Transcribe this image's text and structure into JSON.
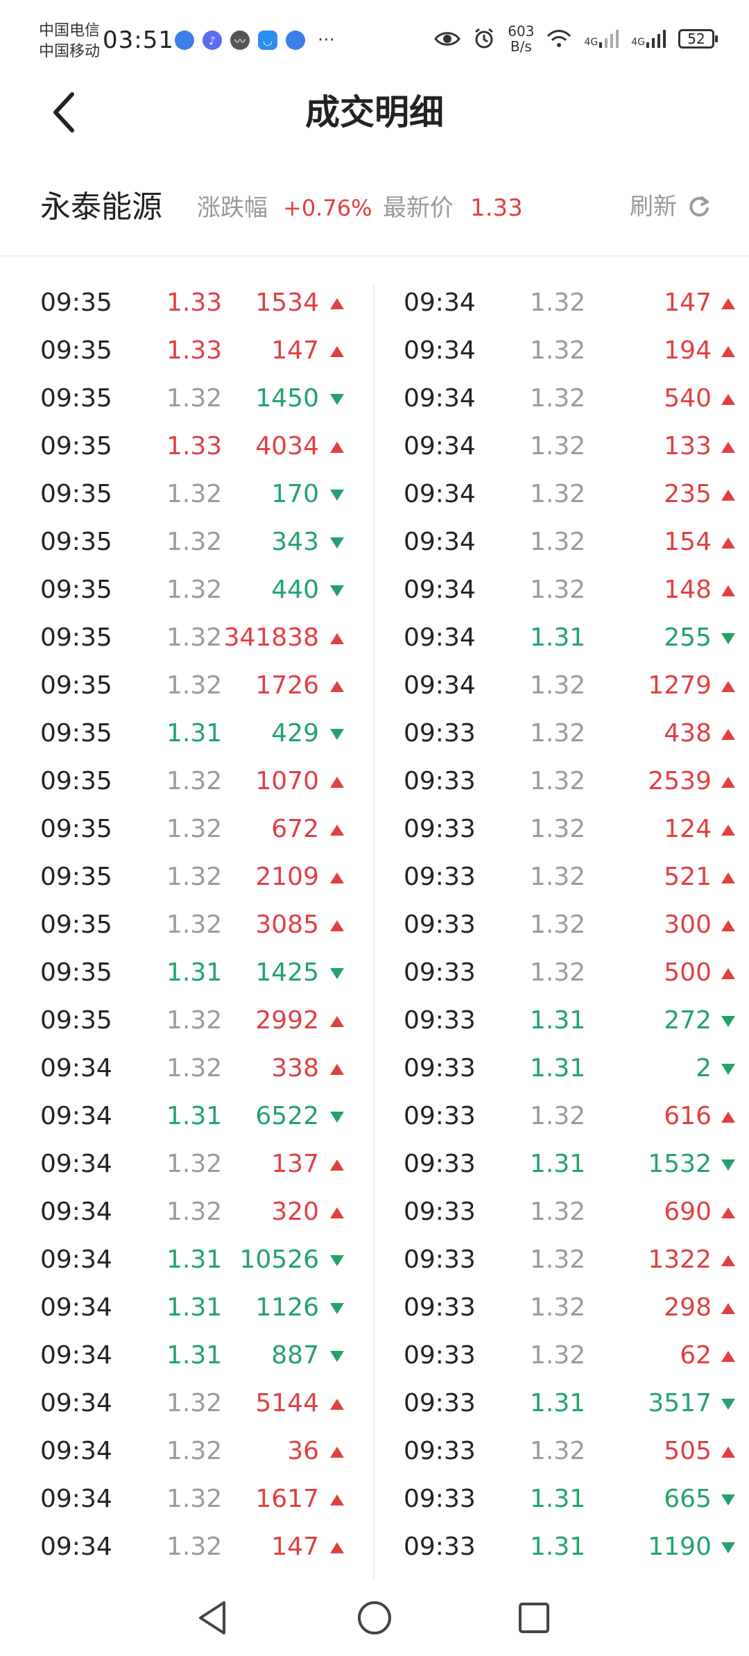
{
  "status_bar": {
    "carrier1": "中国电信",
    "carrier2": "中国移动",
    "time": "03:51",
    "net_speed_value": "603",
    "net_speed_unit": "B/s",
    "signal1": "4G",
    "signal2": "4G",
    "battery": "52"
  },
  "header": {
    "title": "成交明细"
  },
  "stock": {
    "name": "永泰能源",
    "change_label": "涨跌幅",
    "change_value": "+0.76%",
    "price_label": "最新价",
    "price_value": "1.33",
    "refresh_label": "刷新"
  },
  "colors": {
    "up": "#e04040",
    "down": "#22a36a",
    "flat": "#9a9a9a"
  },
  "trades_left": [
    {
      "time": "09:35",
      "price": "1.33",
      "volume": "1534",
      "dir": "up",
      "price_dir": "up"
    },
    {
      "time": "09:35",
      "price": "1.33",
      "volume": "147",
      "dir": "up",
      "price_dir": "up"
    },
    {
      "time": "09:35",
      "price": "1.32",
      "volume": "1450",
      "dir": "down",
      "price_dir": "flat"
    },
    {
      "time": "09:35",
      "price": "1.33",
      "volume": "4034",
      "dir": "up",
      "price_dir": "up"
    },
    {
      "time": "09:35",
      "price": "1.32",
      "volume": "170",
      "dir": "down",
      "price_dir": "flat"
    },
    {
      "time": "09:35",
      "price": "1.32",
      "volume": "343",
      "dir": "down",
      "price_dir": "flat"
    },
    {
      "time": "09:35",
      "price": "1.32",
      "volume": "440",
      "dir": "down",
      "price_dir": "flat"
    },
    {
      "time": "09:35",
      "price": "1.32",
      "volume": "341838",
      "dir": "up",
      "price_dir": "flat"
    },
    {
      "time": "09:35",
      "price": "1.32",
      "volume": "1726",
      "dir": "up",
      "price_dir": "flat"
    },
    {
      "time": "09:35",
      "price": "1.31",
      "volume": "429",
      "dir": "down",
      "price_dir": "down"
    },
    {
      "time": "09:35",
      "price": "1.32",
      "volume": "1070",
      "dir": "up",
      "price_dir": "flat"
    },
    {
      "time": "09:35",
      "price": "1.32",
      "volume": "672",
      "dir": "up",
      "price_dir": "flat"
    },
    {
      "time": "09:35",
      "price": "1.32",
      "volume": "2109",
      "dir": "up",
      "price_dir": "flat"
    },
    {
      "time": "09:35",
      "price": "1.32",
      "volume": "3085",
      "dir": "up",
      "price_dir": "flat"
    },
    {
      "time": "09:35",
      "price": "1.31",
      "volume": "1425",
      "dir": "down",
      "price_dir": "down"
    },
    {
      "time": "09:35",
      "price": "1.32",
      "volume": "2992",
      "dir": "up",
      "price_dir": "flat"
    },
    {
      "time": "09:34",
      "price": "1.32",
      "volume": "338",
      "dir": "up",
      "price_dir": "flat"
    },
    {
      "time": "09:34",
      "price": "1.31",
      "volume": "6522",
      "dir": "down",
      "price_dir": "down"
    },
    {
      "time": "09:34",
      "price": "1.32",
      "volume": "137",
      "dir": "up",
      "price_dir": "flat"
    },
    {
      "time": "09:34",
      "price": "1.32",
      "volume": "320",
      "dir": "up",
      "price_dir": "flat"
    },
    {
      "time": "09:34",
      "price": "1.31",
      "volume": "10526",
      "dir": "down",
      "price_dir": "down"
    },
    {
      "time": "09:34",
      "price": "1.31",
      "volume": "1126",
      "dir": "down",
      "price_dir": "down"
    },
    {
      "time": "09:34",
      "price": "1.31",
      "volume": "887",
      "dir": "down",
      "price_dir": "down"
    },
    {
      "time": "09:34",
      "price": "1.32",
      "volume": "5144",
      "dir": "up",
      "price_dir": "flat"
    },
    {
      "time": "09:34",
      "price": "1.32",
      "volume": "36",
      "dir": "up",
      "price_dir": "flat"
    },
    {
      "time": "09:34",
      "price": "1.32",
      "volume": "1617",
      "dir": "up",
      "price_dir": "flat"
    },
    {
      "time": "09:34",
      "price": "1.32",
      "volume": "147",
      "dir": "up",
      "price_dir": "flat"
    }
  ],
  "trades_right": [
    {
      "time": "09:34",
      "price": "1.32",
      "volume": "147",
      "dir": "up",
      "price_dir": "flat"
    },
    {
      "time": "09:34",
      "price": "1.32",
      "volume": "194",
      "dir": "up",
      "price_dir": "flat"
    },
    {
      "time": "09:34",
      "price": "1.32",
      "volume": "540",
      "dir": "up",
      "price_dir": "flat"
    },
    {
      "time": "09:34",
      "price": "1.32",
      "volume": "133",
      "dir": "up",
      "price_dir": "flat"
    },
    {
      "time": "09:34",
      "price": "1.32",
      "volume": "235",
      "dir": "up",
      "price_dir": "flat"
    },
    {
      "time": "09:34",
      "price": "1.32",
      "volume": "154",
      "dir": "up",
      "price_dir": "flat"
    },
    {
      "time": "09:34",
      "price": "1.32",
      "volume": "148",
      "dir": "up",
      "price_dir": "flat"
    },
    {
      "time": "09:34",
      "price": "1.31",
      "volume": "255",
      "dir": "down",
      "price_dir": "down"
    },
    {
      "time": "09:34",
      "price": "1.32",
      "volume": "1279",
      "dir": "up",
      "price_dir": "flat"
    },
    {
      "time": "09:33",
      "price": "1.32",
      "volume": "438",
      "dir": "up",
      "price_dir": "flat"
    },
    {
      "time": "09:33",
      "price": "1.32",
      "volume": "2539",
      "dir": "up",
      "price_dir": "flat"
    },
    {
      "time": "09:33",
      "price": "1.32",
      "volume": "124",
      "dir": "up",
      "price_dir": "flat"
    },
    {
      "time": "09:33",
      "price": "1.32",
      "volume": "521",
      "dir": "up",
      "price_dir": "flat"
    },
    {
      "time": "09:33",
      "price": "1.32",
      "volume": "300",
      "dir": "up",
      "price_dir": "flat"
    },
    {
      "time": "09:33",
      "price": "1.32",
      "volume": "500",
      "dir": "up",
      "price_dir": "flat"
    },
    {
      "time": "09:33",
      "price": "1.31",
      "volume": "272",
      "dir": "down",
      "price_dir": "down"
    },
    {
      "time": "09:33",
      "price": "1.31",
      "volume": "2",
      "dir": "down",
      "price_dir": "down"
    },
    {
      "time": "09:33",
      "price": "1.32",
      "volume": "616",
      "dir": "up",
      "price_dir": "flat"
    },
    {
      "time": "09:33",
      "price": "1.31",
      "volume": "1532",
      "dir": "down",
      "price_dir": "down"
    },
    {
      "time": "09:33",
      "price": "1.32",
      "volume": "690",
      "dir": "up",
      "price_dir": "flat"
    },
    {
      "time": "09:33",
      "price": "1.32",
      "volume": "1322",
      "dir": "up",
      "price_dir": "flat"
    },
    {
      "time": "09:33",
      "price": "1.32",
      "volume": "298",
      "dir": "up",
      "price_dir": "flat"
    },
    {
      "time": "09:33",
      "price": "1.32",
      "volume": "62",
      "dir": "up",
      "price_dir": "flat"
    },
    {
      "time": "09:33",
      "price": "1.31",
      "volume": "3517",
      "dir": "down",
      "price_dir": "down"
    },
    {
      "time": "09:33",
      "price": "1.32",
      "volume": "505",
      "dir": "up",
      "price_dir": "flat"
    },
    {
      "time": "09:33",
      "price": "1.31",
      "volume": "665",
      "dir": "down",
      "price_dir": "down"
    },
    {
      "time": "09:33",
      "price": "1.31",
      "volume": "1190",
      "dir": "down",
      "price_dir": "down"
    }
  ]
}
